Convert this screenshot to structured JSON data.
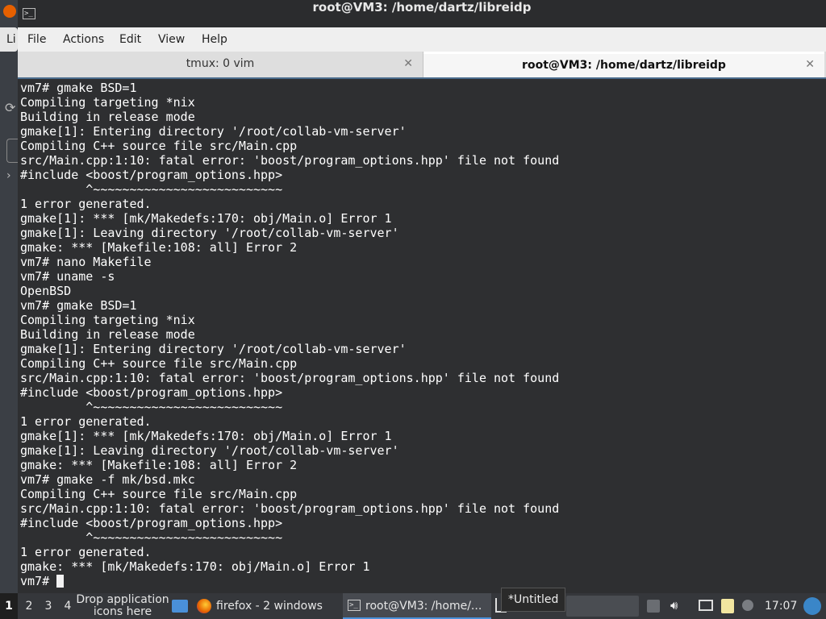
{
  "background_app": {
    "tab_fragment": "Li"
  },
  "window": {
    "title": "root@VM3: /home/dartz/libreidp"
  },
  "menu": [
    "File",
    "Actions",
    "Edit",
    "View",
    "Help"
  ],
  "tabs": [
    {
      "label": "tmux: 0 vim",
      "close": "✕"
    },
    {
      "label": "root@VM3: /home/dartz/libreidp",
      "close": "✕"
    }
  ],
  "terminal": {
    "lines": [
      "vm7# gmake BSD=1",
      "Compiling targeting *nix",
      "Building in release mode",
      "gmake[1]: Entering directory '/root/collab-vm-server'",
      "Compiling C++ source file src/Main.cpp",
      "src/Main.cpp:1:10: fatal error: 'boost/program_options.hpp' file not found",
      "#include <boost/program_options.hpp>",
      "         ^~~~~~~~~~~~~~~~~~~~~~~~~~~",
      "1 error generated.",
      "gmake[1]: *** [mk/Makedefs:170: obj/Main.o] Error 1",
      "gmake[1]: Leaving directory '/root/collab-vm-server'",
      "gmake: *** [Makefile:108: all] Error 2",
      "vm7# nano Makefile",
      "vm7# uname -s",
      "OpenBSD",
      "vm7# gmake BSD=1",
      "Compiling targeting *nix",
      "Building in release mode",
      "gmake[1]: Entering directory '/root/collab-vm-server'",
      "Compiling C++ source file src/Main.cpp",
      "src/Main.cpp:1:10: fatal error: 'boost/program_options.hpp' file not found",
      "#include <boost/program_options.hpp>",
      "         ^~~~~~~~~~~~~~~~~~~~~~~~~~~",
      "1 error generated.",
      "gmake[1]: *** [mk/Makedefs:170: obj/Main.o] Error 1",
      "gmake[1]: Leaving directory '/root/collab-vm-server'",
      "gmake: *** [Makefile:108: all] Error 2",
      "vm7# gmake -f mk/bsd.mkc",
      "Compiling C++ source file src/Main.cpp",
      "src/Main.cpp:1:10: fatal error: 'boost/program_options.hpp' file not found",
      "#include <boost/program_options.hpp>",
      "         ^~~~~~~~~~~~~~~~~~~~~~~~~~~",
      "1 error generated.",
      "gmake: *** [mk/Makedefs:170: obj/Main.o] Error 1"
    ],
    "prompt": "vm7# "
  },
  "taskbar": {
    "workspaces": [
      "1",
      "2",
      "3",
      "4"
    ],
    "drop_hint": "Drop application icons here",
    "tasks": {
      "firefox": "firefox - 2 windows",
      "terminal": "root@VM3: /home/..."
    },
    "tooltip": "*Untitled",
    "clock": "17:07"
  },
  "colors": {
    "terminal_bg": "#2e2f31",
    "terminal_fg": "#ffffff",
    "active_indicator": "#4a90d9"
  }
}
